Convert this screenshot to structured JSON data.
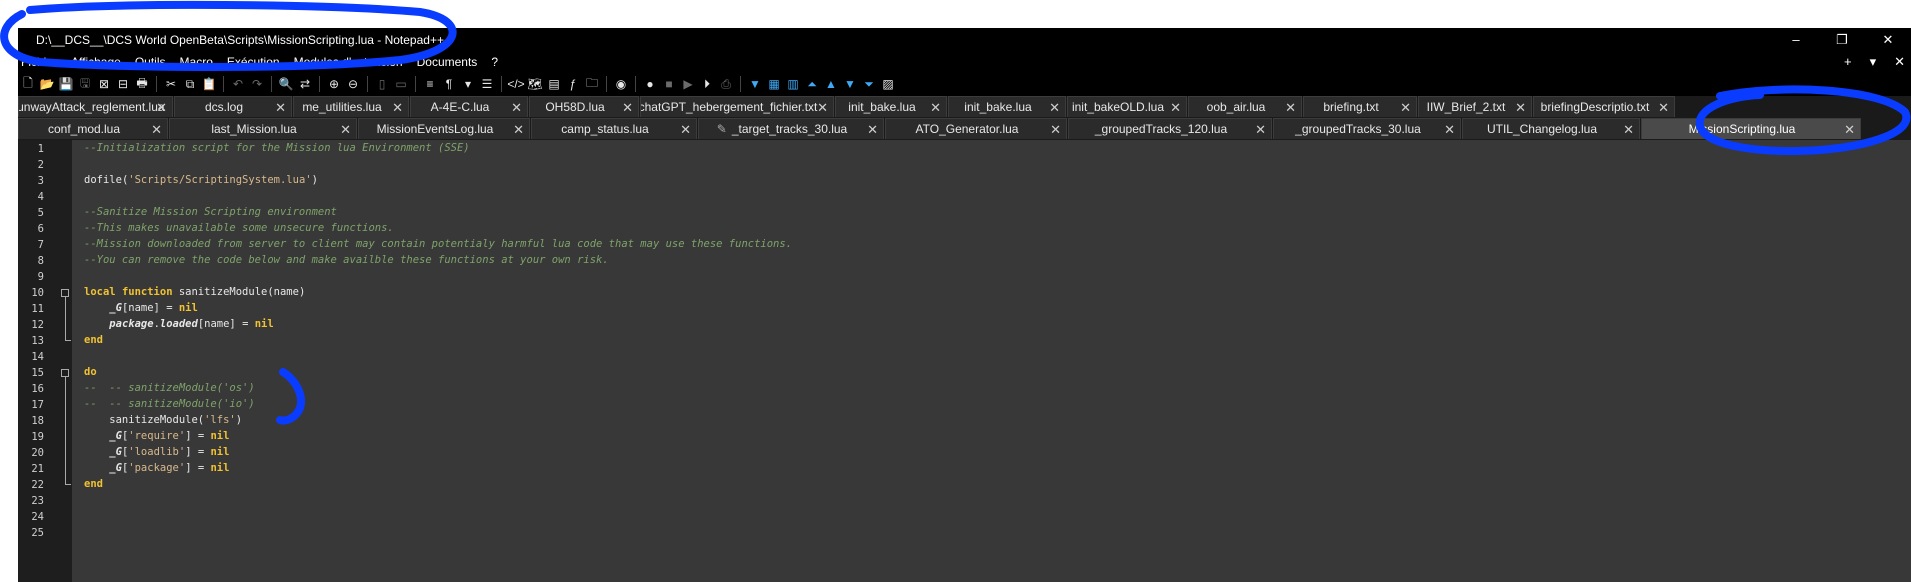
{
  "window": {
    "title": "D:\\__DCS__\\DCS World OpenBeta\\Scripts\\MissionScripting.lua - Notepad++",
    "controls": [
      "–",
      "❐",
      "✕"
    ]
  },
  "menu": {
    "items": [
      "Fichier",
      "Affichage",
      "Outils",
      "Macro",
      "Exécution",
      "Modules d'extension",
      "Documents",
      "?"
    ],
    "right": [
      "+",
      "▾",
      "✕"
    ]
  },
  "tabs_row1": [
    {
      "label": "RunwayAttack_reglement.lua"
    },
    {
      "label": "dcs.log"
    },
    {
      "label": "me_utilities.lua"
    },
    {
      "label": "A-4E-C.lua"
    },
    {
      "label": "OH58D.lua"
    },
    {
      "label": "chatGPT_hebergement_fichier.txt"
    },
    {
      "label": "init_bake.lua"
    },
    {
      "label": "init_bake.lua"
    },
    {
      "label": "init_bakeOLD.lua"
    },
    {
      "label": "oob_air.lua"
    },
    {
      "label": "briefing.txt"
    },
    {
      "label": "IIW_Brief_2.txt"
    },
    {
      "label": "briefingDescriptio.txt"
    }
  ],
  "tabs_row2": [
    {
      "label": "conf_mod.lua"
    },
    {
      "label": "last_Mission.lua"
    },
    {
      "label": "MissionEventsLog.lua"
    },
    {
      "label": "camp_status.lua"
    },
    {
      "label": "_target_tracks_30.lua"
    },
    {
      "label": "ATO_Generator.lua"
    },
    {
      "label": "_groupedTracks_120.lua"
    },
    {
      "label": "_groupedTracks_30.lua"
    },
    {
      "label": "UTIL_Changelog.lua"
    },
    {
      "label": "MissionScripting.lua"
    }
  ],
  "editor": {
    "line_numbers": [
      "1",
      "2",
      "3",
      "4",
      "5",
      "6",
      "7",
      "8",
      "9",
      "10",
      "11",
      "12",
      "13",
      "14",
      "15",
      "16",
      "17",
      "18",
      "19",
      "20",
      "21",
      "22",
      "23",
      "24",
      "25"
    ],
    "lines": [
      [
        {
          "t": "--Initialization script for the Mission lua Environment (SSE)",
          "c": "cm"
        }
      ],
      [],
      [
        {
          "t": "dofile",
          "c": "fn"
        },
        {
          "t": "(",
          "c": "fn"
        },
        {
          "t": "'Scripts/ScriptingSystem.lua'",
          "c": "str"
        },
        {
          "t": ")",
          "c": "fn"
        }
      ],
      [],
      [
        {
          "t": "--Sanitize Mission Scripting environment",
          "c": "cm"
        }
      ],
      [
        {
          "t": "--This makes unavailable some unsecure functions.",
          "c": "cm"
        }
      ],
      [
        {
          "t": "--Mission downloaded from server to client may contain potentialy harmful lua code that may use these functions.",
          "c": "cm"
        }
      ],
      [
        {
          "t": "--You can remove the code below and make availble these functions at your own risk.",
          "c": "cm"
        }
      ],
      [],
      [
        {
          "t": "local",
          "c": "kw"
        },
        {
          "t": " ",
          "c": "fn"
        },
        {
          "t": "function",
          "c": "kw"
        },
        {
          "t": " sanitizeModule(name)",
          "c": "fn"
        }
      ],
      [
        {
          "t": "    ",
          "c": "fn"
        },
        {
          "t": "_G",
          "c": "var"
        },
        {
          "t": "[name] = ",
          "c": "fn"
        },
        {
          "t": "nil",
          "c": "nil"
        }
      ],
      [
        {
          "t": "    ",
          "c": "fn"
        },
        {
          "t": "package",
          "c": "var"
        },
        {
          "t": ".",
          "c": "fn"
        },
        {
          "t": "loaded",
          "c": "var"
        },
        {
          "t": "[name] = ",
          "c": "fn"
        },
        {
          "t": "nil",
          "c": "nil"
        }
      ],
      [
        {
          "t": "end",
          "c": "kw"
        }
      ],
      [],
      [
        {
          "t": "do",
          "c": "kw"
        }
      ],
      [
        {
          "t": "--  -- sanitizeModule('os')",
          "c": "cm"
        }
      ],
      [
        {
          "t": "--  -- sanitizeModule('io')",
          "c": "cm"
        }
      ],
      [
        {
          "t": "    sanitizeModule(",
          "c": "fn"
        },
        {
          "t": "'lfs'",
          "c": "str"
        },
        {
          "t": ")",
          "c": "fn"
        }
      ],
      [
        {
          "t": "    ",
          "c": "fn"
        },
        {
          "t": "_G",
          "c": "var"
        },
        {
          "t": "[",
          "c": "fn"
        },
        {
          "t": "'require'",
          "c": "str"
        },
        {
          "t": "] = ",
          "c": "fn"
        },
        {
          "t": "nil",
          "c": "nil"
        }
      ],
      [
        {
          "t": "    ",
          "c": "fn"
        },
        {
          "t": "_G",
          "c": "var"
        },
        {
          "t": "[",
          "c": "fn"
        },
        {
          "t": "'loadlib'",
          "c": "str"
        },
        {
          "t": "] = ",
          "c": "fn"
        },
        {
          "t": "nil",
          "c": "nil"
        }
      ],
      [
        {
          "t": "    ",
          "c": "fn"
        },
        {
          "t": "_G",
          "c": "var"
        },
        {
          "t": "[",
          "c": "fn"
        },
        {
          "t": "'package'",
          "c": "str"
        },
        {
          "t": "] = ",
          "c": "fn"
        },
        {
          "t": "nil",
          "c": "nil"
        }
      ],
      [
        {
          "t": "end",
          "c": "kw"
        }
      ],
      [],
      [],
      []
    ]
  },
  "colors": {
    "annotation": "#0a3cff",
    "background": "#383838"
  }
}
